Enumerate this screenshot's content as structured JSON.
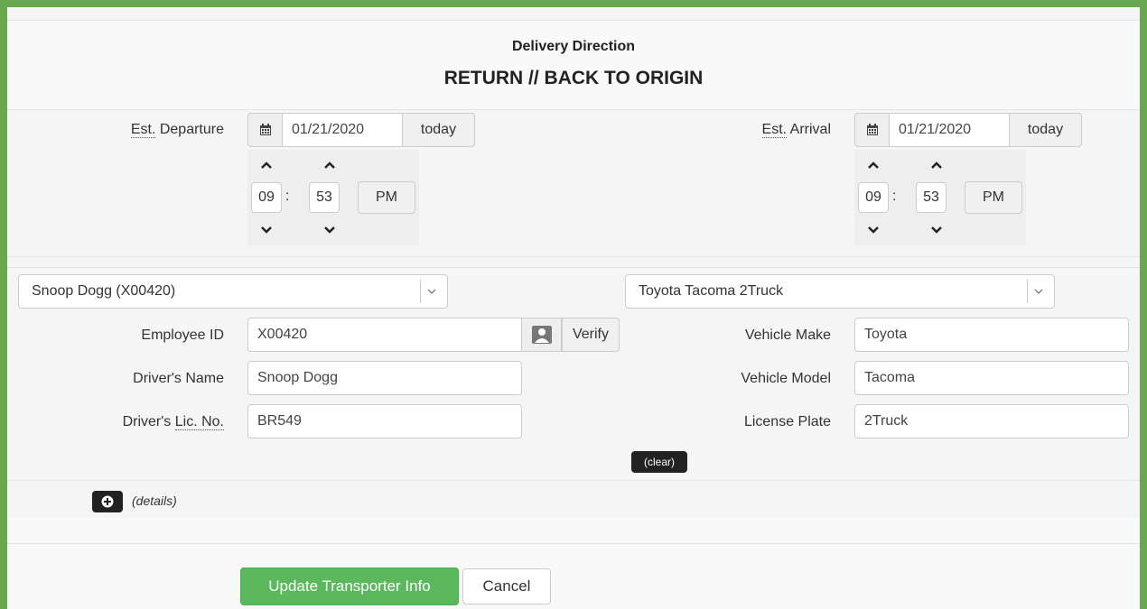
{
  "header": {
    "label": "Delivery Direction",
    "title": "RETURN // BACK TO ORIGIN"
  },
  "departure": {
    "label_abbr": "Est.",
    "label_rest": " Departure",
    "date": "01/21/2020",
    "today_label": "today",
    "hour": "09",
    "minute": "53",
    "separator": ":",
    "period": "PM"
  },
  "arrival": {
    "label_abbr": "Est.",
    "label_rest": " Arrival",
    "date": "01/21/2020",
    "today_label": "today",
    "hour": "09",
    "minute": "53",
    "separator": ":",
    "period": "PM"
  },
  "driver": {
    "select_value": "Snoop Dogg (X00420)",
    "employee_id_label": "Employee ID",
    "employee_id": "X00420",
    "verify_label": "Verify",
    "name_label": "Driver's Name",
    "name": "Snoop Dogg",
    "license_label_pre": "Driver's ",
    "license_label_abbr": "Lic. No.",
    "license": "BR549"
  },
  "vehicle": {
    "select_value": "Toyota Tacoma 2Truck",
    "make_label": "Vehicle Make",
    "make": "Toyota",
    "model_label": "Vehicle Model",
    "model": "Tacoma",
    "plate_label": "License Plate",
    "plate": "2Truck",
    "clear_label": "(clear)"
  },
  "details": {
    "label": "(details)"
  },
  "footer": {
    "update_label": "Update Transporter Info",
    "cancel_label": "Cancel"
  },
  "colors": {
    "frame_green": "#6aa84f",
    "success_green": "#5cb85c",
    "dark_button": "#222222"
  }
}
